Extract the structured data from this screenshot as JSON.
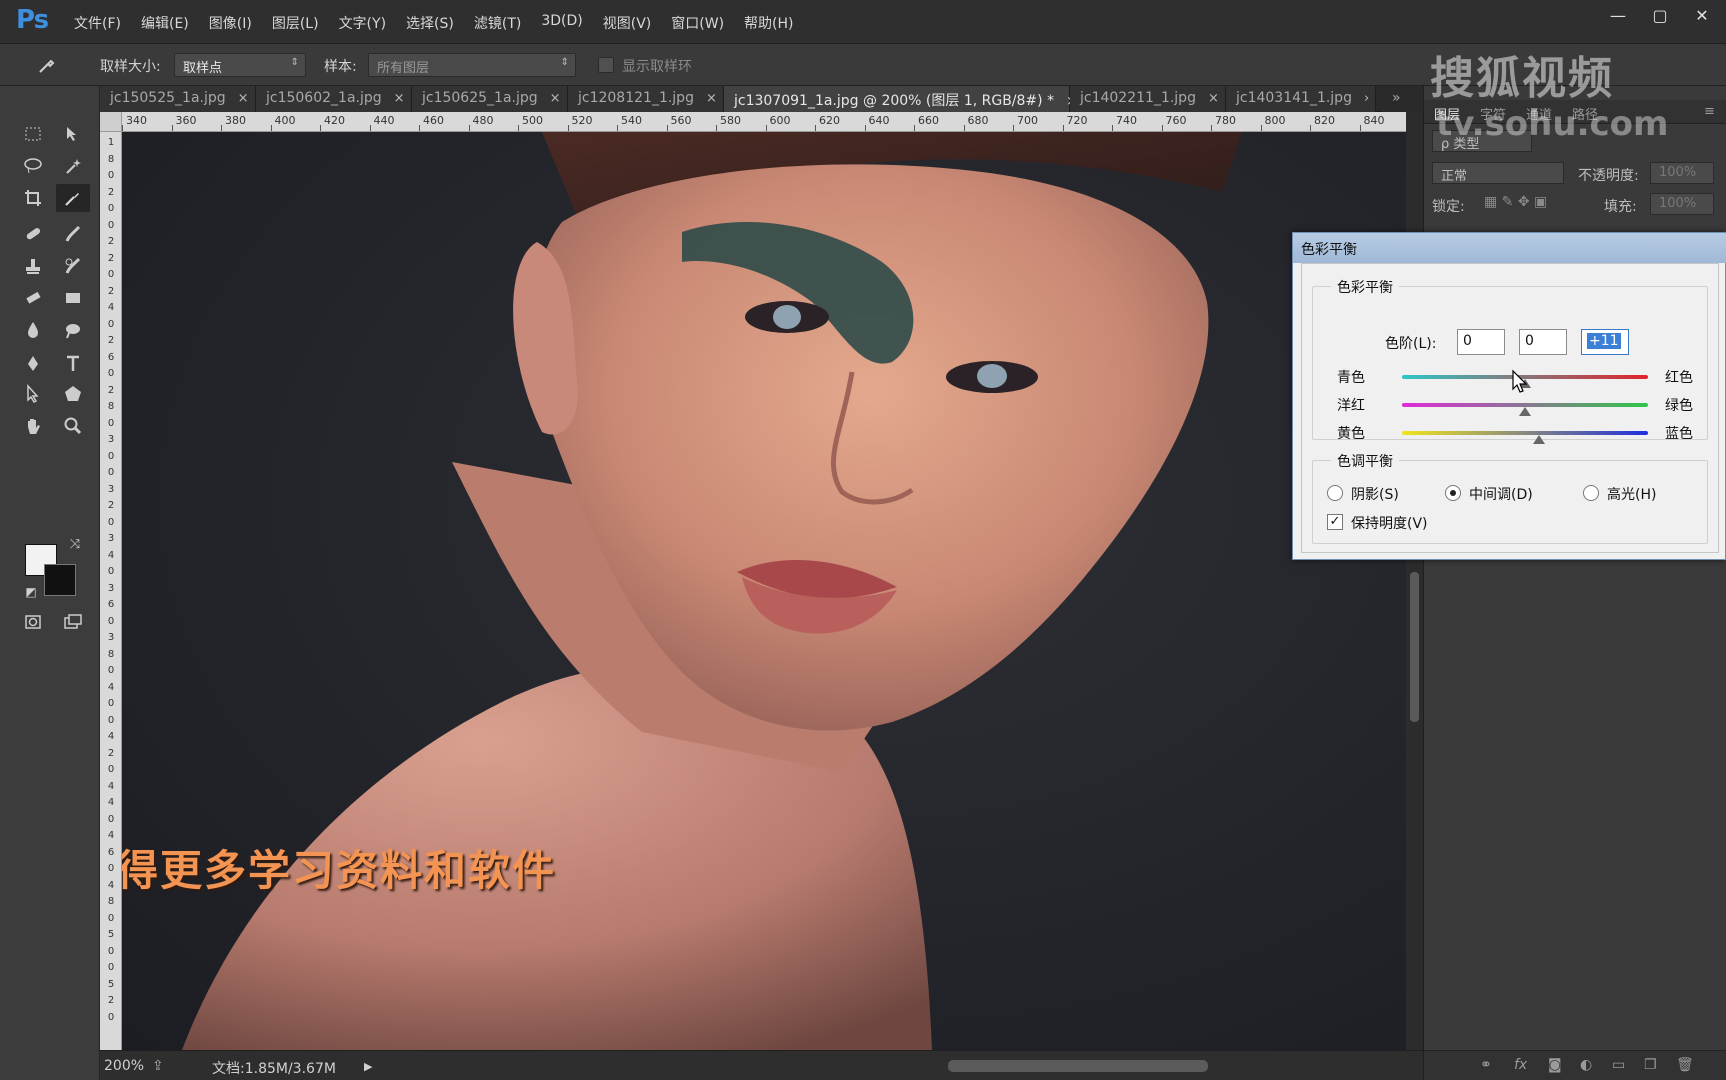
{
  "app": {
    "logo": "Ps"
  },
  "menu": [
    "文件(F)",
    "编辑(E)",
    "图像(I)",
    "图层(L)",
    "文字(Y)",
    "选择(S)",
    "滤镜(T)",
    "3D(D)",
    "视图(V)",
    "窗口(W)",
    "帮助(H)"
  ],
  "window_controls": {
    "minimize": "—",
    "maximize": "▢",
    "close": "✕"
  },
  "options": {
    "sample_size_label": "取样大小:",
    "sample_size_value": "取样点",
    "sample_label": "样本:",
    "sample_value": "所有图层",
    "show_ring_label": "显示取样环"
  },
  "tabs": [
    {
      "label": "jc150525_1a.jpg",
      "close": "×"
    },
    {
      "label": "jc150602_1a.jpg",
      "close": "×"
    },
    {
      "label": "jc150625_1a.jpg",
      "close": "×"
    },
    {
      "label": "jc1208121_1.jpg",
      "close": "×"
    },
    {
      "label": "jc1307091_1a.jpg @ 200% (图层 1, RGB/8#) *",
      "close": "×"
    },
    {
      "label": "jc1402211_1.jpg",
      "close": "×"
    },
    {
      "label": "jc1403141_1.jpg",
      "close": "›"
    }
  ],
  "tabs_overflow": "»",
  "ruler_top": [
    "340",
    "360",
    "380",
    "400",
    "420",
    "440",
    "460",
    "480",
    "500",
    "520",
    "540",
    "560",
    "580",
    "600",
    "620",
    "640",
    "660",
    "680",
    "700",
    "720",
    "740",
    "760",
    "780",
    "800",
    "820",
    "840"
  ],
  "ruler_left": [
    "1",
    "8",
    "0",
    "2",
    "0",
    "0",
    "2",
    "2",
    "0",
    "2",
    "4",
    "0",
    "2",
    "6",
    "0",
    "2",
    "8",
    "0",
    "3",
    "0",
    "0",
    "3",
    "2",
    "0",
    "3",
    "4",
    "0",
    "3",
    "6",
    "0",
    "3",
    "8",
    "0",
    "4",
    "0",
    "0",
    "4",
    "2",
    "0",
    "4",
    "4",
    "0",
    "4",
    "6",
    "0",
    "4",
    "8",
    "0",
    "5",
    "0",
    "0",
    "5",
    "2",
    "0"
  ],
  "caption": "得更多学习资料和软件",
  "status": {
    "zoom": "200%",
    "doc": "文档:1.85M/3.67M",
    "arrow": "▶"
  },
  "panel": {
    "tabs": [
      "图层",
      "字符",
      "通道",
      "路径"
    ],
    "kind_label": "ρ 类型",
    "blend_mode": "正常",
    "opacity_label": "不透明度:",
    "opacity_value": "100%",
    "lock_label": "锁定:",
    "fill_label": "填充:",
    "fill_value": "100%",
    "footer_icons": [
      "link-icon",
      "fx-icon",
      "mask-icon",
      "adjustment-icon",
      "folder-icon",
      "new-layer-icon",
      "trash-icon"
    ]
  },
  "watermark": {
    "brand": "搜狐视频",
    "url": "tv.sohu.com"
  },
  "dialog": {
    "title": "色彩平衡",
    "balance_group": "色彩平衡",
    "levels_label": "色阶(L):",
    "levels": [
      "0",
      "0",
      "+11"
    ],
    "sliders": [
      {
        "left": "青色",
        "right": "红色",
        "value": 0,
        "from": "#2fc6c4",
        "to": "#e0232d"
      },
      {
        "left": "洋红",
        "right": "绿色",
        "value": 0,
        "from": "#e02ad8",
        "to": "#2fc64a"
      },
      {
        "left": "黄色",
        "right": "蓝色",
        "value": 11,
        "from": "#f0e41e",
        "to": "#1f2ee0"
      }
    ],
    "tone_group": "色调平衡",
    "tones": [
      {
        "label": "阴影(S)",
        "checked": false
      },
      {
        "label": "中间调(D)",
        "checked": true
      },
      {
        "label": "高光(H)",
        "checked": false
      }
    ],
    "preserve_label": "保持明度(V)",
    "preserve_checked": true
  }
}
